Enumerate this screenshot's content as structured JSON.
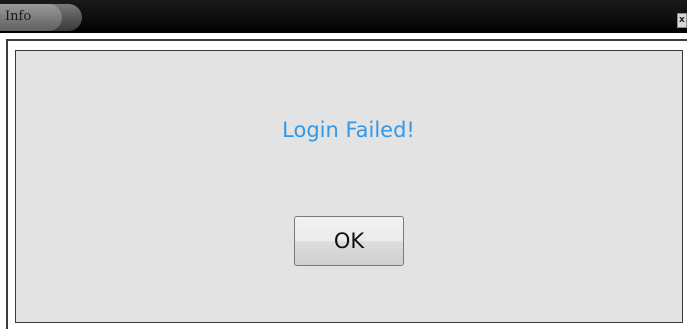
{
  "window": {
    "title": "Info",
    "close_glyph": "x"
  },
  "dialog": {
    "message": "Login Failed!",
    "ok_label": "OK"
  },
  "colors": {
    "message_text": "#3399e6",
    "panel_background": "#e3e3e3",
    "titlebar_background": "#000000"
  },
  "icons": {
    "close": "close-icon"
  }
}
